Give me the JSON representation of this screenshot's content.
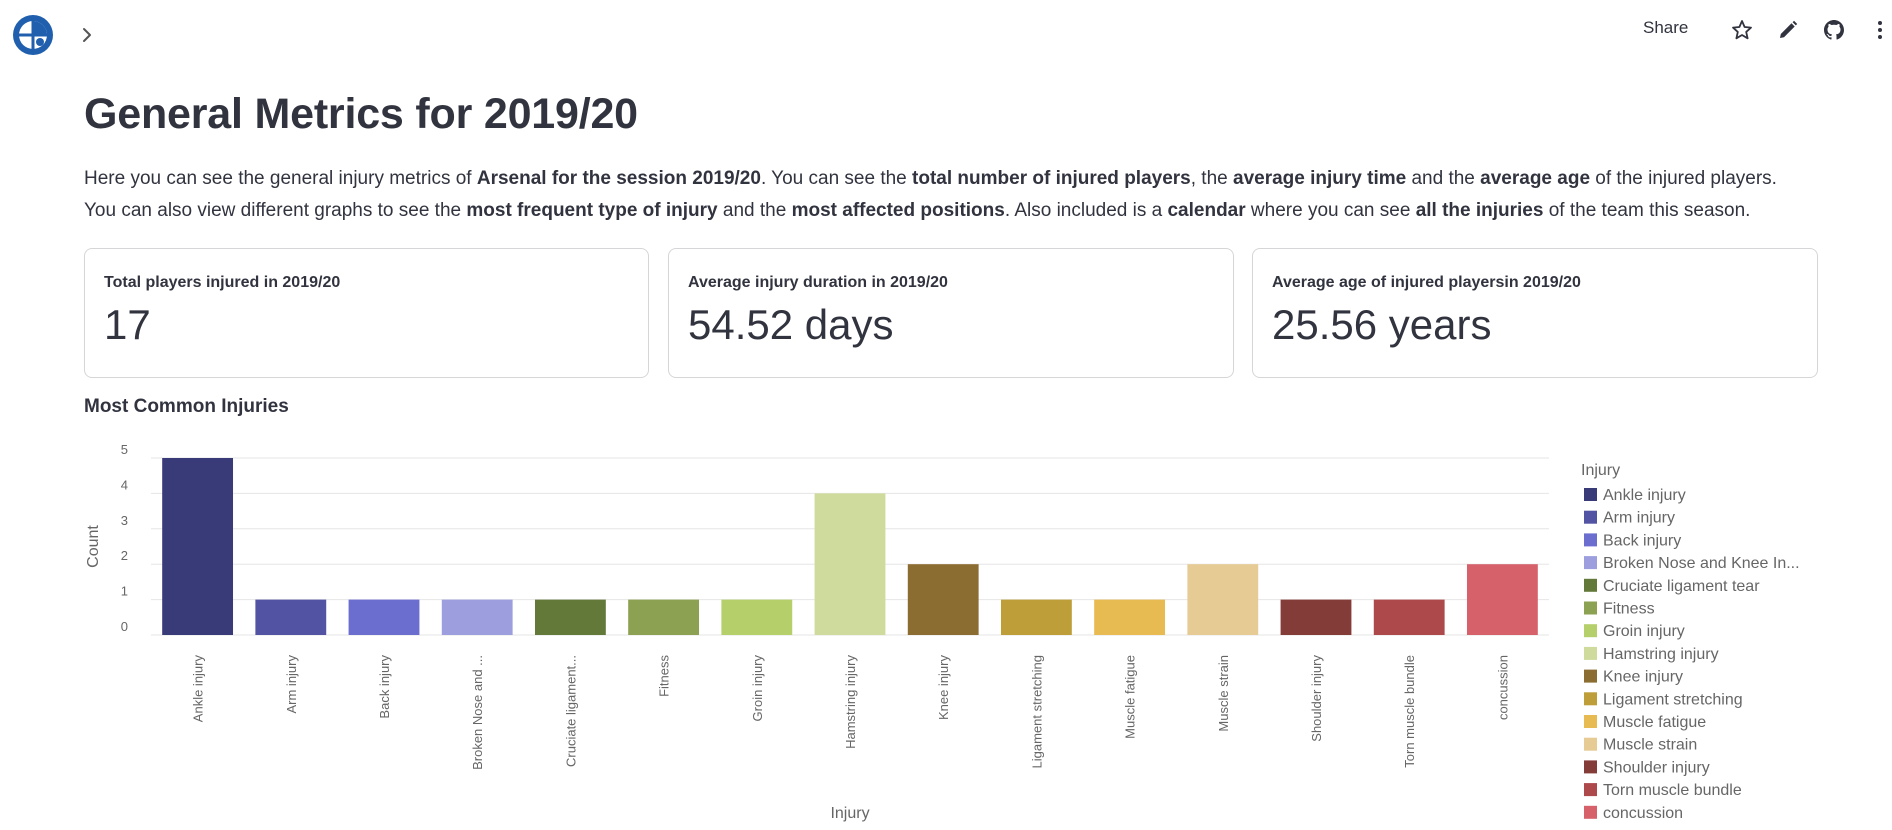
{
  "toolbar": {
    "share_label": "Share",
    "icons": [
      "star-icon",
      "pencil-icon",
      "github-icon",
      "more-vertical-icon"
    ]
  },
  "page": {
    "title": "General Metrics for 2019/20",
    "intro": [
      {
        "t": "Here you can see the general injury metrics of ",
        "b": false
      },
      {
        "t": "Arsenal for the session 2019/20",
        "b": true
      },
      {
        "t": ". You can see the ",
        "b": false
      },
      {
        "t": "total number of injured players",
        "b": true
      },
      {
        "t": ", the ",
        "b": false
      },
      {
        "t": "average injury time",
        "b": true
      },
      {
        "t": " and the ",
        "b": false
      },
      {
        "t": "average age",
        "b": true
      },
      {
        "t": " of the injured players. You can also view different graphs to see the ",
        "b": false
      },
      {
        "t": "most frequent type of injury",
        "b": true
      },
      {
        "t": " and the ",
        "b": false
      },
      {
        "t": "most affected positions",
        "b": true
      },
      {
        "t": ". Also included is a ",
        "b": false
      },
      {
        "t": "calendar",
        "b": true
      },
      {
        "t": " where you can see ",
        "b": false
      },
      {
        "t": "all the injuries",
        "b": true
      },
      {
        "t": " of the team this season.",
        "b": false
      }
    ]
  },
  "metrics": [
    {
      "label": "Total players injured in 2019/20",
      "value": "17"
    },
    {
      "label": "Average injury duration in 2019/20",
      "value": "54.52 days"
    },
    {
      "label": "Average age of injured playersin 2019/20",
      "value": "25.56 years"
    }
  ],
  "section": {
    "title": "Most Common Injuries"
  },
  "chart_data": {
    "type": "bar",
    "title": "",
    "xlabel": "Injury",
    "ylabel": "Count",
    "ylim": [
      0,
      5
    ],
    "yticks": [
      0,
      1,
      2,
      3,
      4,
      5
    ],
    "grid": true,
    "legend_title": "Injury",
    "legend_position": "right",
    "categories": [
      "Ankle injury",
      "Arm injury",
      "Back injury",
      "Broken Nose and Knee Injury",
      "Cruciate ligament tear",
      "Fitness",
      "Groin injury",
      "Hamstring injury",
      "Knee injury",
      "Ligament stretching",
      "Muscle fatigue",
      "Muscle strain",
      "Shoulder injury",
      "Torn muscle bundle",
      "concussion"
    ],
    "tick_labels": [
      "Ankle injury",
      "Arm injury",
      "Back injury",
      "Broken Nose and ...",
      "Cruciate ligament...",
      "Fitness",
      "Groin injury",
      "Hamstring injury",
      "Knee injury",
      "Ligament stretching",
      "Muscle fatigue",
      "Muscle strain",
      "Shoulder injury",
      "Torn muscle bundle",
      "concussion"
    ],
    "legend_labels": [
      "Ankle injury",
      "Arm injury",
      "Back injury",
      "Broken Nose and Knee In...",
      "Cruciate ligament tear",
      "Fitness",
      "Groin injury",
      "Hamstring injury",
      "Knee injury",
      "Ligament stretching",
      "Muscle fatigue",
      "Muscle strain",
      "Shoulder injury",
      "Torn muscle bundle",
      "concussion"
    ],
    "values": [
      5,
      1,
      1,
      1,
      1,
      1,
      1,
      4,
      2,
      1,
      1,
      2,
      1,
      1,
      2
    ],
    "colors": [
      "#393b79",
      "#5254a3",
      "#6b6ecf",
      "#9c9ede",
      "#637939",
      "#8ca252",
      "#b5cf6b",
      "#cedb9c",
      "#8c6d31",
      "#bd9e39",
      "#e7ba52",
      "#e7cb94",
      "#843c39",
      "#ad494a",
      "#d6616b"
    ]
  }
}
